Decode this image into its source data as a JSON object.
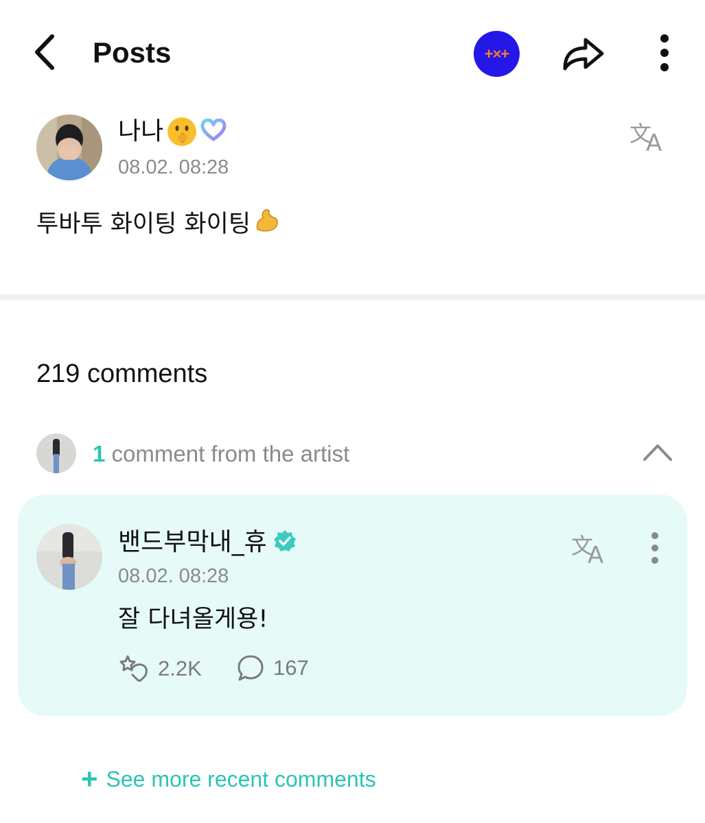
{
  "header": {
    "title": "Posts",
    "community_badge": "+×+",
    "back_icon": "chevron-left-icon",
    "share_icon": "share-arrow-icon",
    "more_icon": "more-vertical-icon"
  },
  "post": {
    "author_name": "나나",
    "author_emoji": "shushing-face-emoji",
    "membership_icon": "heart-badge-icon",
    "timestamp": "08.02. 08:28",
    "body": "투바투 화이팅 화이팅",
    "body_emoji": "flexed-biceps-emoji",
    "translate_icon": "translate-icon"
  },
  "comments": {
    "count_label": "219 comments",
    "artist_count": "1",
    "artist_label": "comment from the artist",
    "collapse_icon": "chevron-up-icon",
    "artist_comment": {
      "author_name": "밴드부막내_휴",
      "verified_icon": "verified-badge-icon",
      "timestamp": "08.02. 08:28",
      "body": "잘 다녀올게용!",
      "likes": "2.2K",
      "replies": "167",
      "likes_icon": "cheer-icon",
      "replies_icon": "comment-bubble-icon"
    },
    "see_more_label": "See more recent comments"
  },
  "colors": {
    "accent": "#2bc4b4",
    "card_bg": "#e6faf7",
    "badge_bg": "#2417e8",
    "badge_fg": "#ff7a2e",
    "muted": "#8a8a8a"
  }
}
